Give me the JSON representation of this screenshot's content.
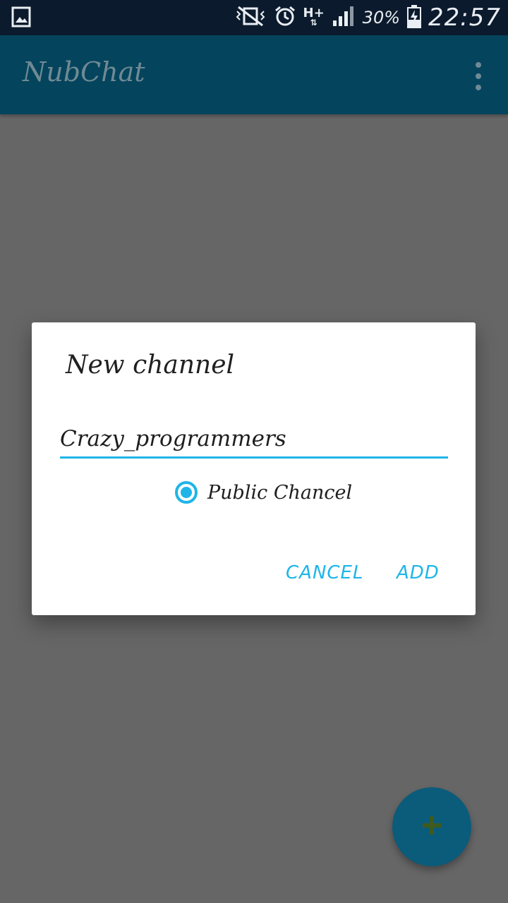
{
  "status_bar": {
    "battery_percent": "30%",
    "time": "22:57",
    "network_label": "H+",
    "icons": [
      "gallery-icon",
      "vibrate-icon",
      "alarm-icon",
      "data-arrows-icon",
      "signal-icon",
      "battery-charging-icon"
    ]
  },
  "app_bar": {
    "title": "NubChat",
    "overflow_icon": "more-vert-icon"
  },
  "dialog": {
    "title": "New channel",
    "channel_name_value": "Crazy_programmers",
    "radio_label": "Public Chancel",
    "radio_selected": true,
    "cancel_label": "CANCEL",
    "add_label": "ADD"
  },
  "fab": {
    "icon": "plus-icon"
  },
  "colors": {
    "accent": "#1fb5e8",
    "app_bar": "#05445d",
    "scrim_background": "#666666",
    "fab": "#0b5b7a",
    "status_bar": "#0b1a2c"
  }
}
